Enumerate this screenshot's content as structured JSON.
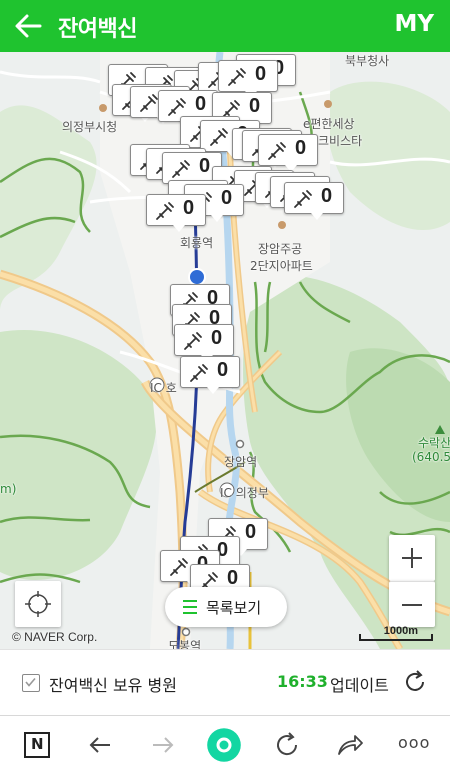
{
  "header": {
    "title": "잔여백신",
    "my_label": "MY"
  },
  "map": {
    "pois": [
      {
        "label": "의정부시청",
        "style": "gray"
      },
      {
        "label": "북부청사",
        "style": "gray"
      },
      {
        "label": "e편한세상",
        "style": "gray"
      },
      {
        "label": "크비스타",
        "style": "gray"
      },
      {
        "label": "회룡역",
        "style": "gray"
      },
      {
        "label": "장암주공",
        "style": "gray"
      },
      {
        "label": "2단지아파트",
        "style": "gray"
      },
      {
        "label": "IC 호",
        "style": "gray"
      },
      {
        "label": "장암역",
        "style": "gray"
      },
      {
        "label": "IC 의정부",
        "style": "gray"
      },
      {
        "label": "수락산",
        "style": "green"
      },
      {
        "label": "(640.5",
        "style": "green"
      },
      {
        "label": "m)",
        "style": "green"
      },
      {
        "label": "도봉역",
        "style": "gray"
      }
    ],
    "markers": [
      {
        "count": "0"
      },
      {
        "count": "0"
      },
      {
        "count": "0"
      },
      {
        "count": "0"
      },
      {
        "count": "0"
      },
      {
        "count": "0"
      },
      {
        "count": "0"
      },
      {
        "count": "0"
      },
      {
        "count": "0"
      },
      {
        "count": "0"
      },
      {
        "count": "0"
      },
      {
        "count": "0"
      },
      {
        "count": "0"
      },
      {
        "count": "0"
      },
      {
        "count": "0"
      },
      {
        "count": "0"
      },
      {
        "count": "0"
      },
      {
        "count": "0"
      },
      {
        "count": "0"
      },
      {
        "count": "0"
      },
      {
        "count": "0"
      },
      {
        "count": "0"
      },
      {
        "count": "0"
      },
      {
        "count": "0"
      },
      {
        "count": "0"
      },
      {
        "count": "0"
      },
      {
        "count": "0"
      },
      {
        "count": "0"
      },
      {
        "count": "0"
      },
      {
        "count": "0"
      }
    ],
    "list_button_label": "목록보기",
    "copyright": "© NAVER Corp.",
    "scale_label": "1000m",
    "zoom_in": "+",
    "zoom_out": "−"
  },
  "filter": {
    "label": "잔여백신 보유 병원",
    "checked": false,
    "update_time": "16:33",
    "update_label": "업데이트"
  },
  "browser_bar": {
    "icons": [
      "naver-n-icon",
      "back-arrow-icon",
      "forward-arrow-icon",
      "home-dot-icon",
      "reload-icon",
      "share-icon",
      "more-icon"
    ],
    "n_label": "N",
    "more_label": "ooo"
  },
  "colors": {
    "accent": "#1fc32f",
    "update_time": "#1fb02c"
  }
}
